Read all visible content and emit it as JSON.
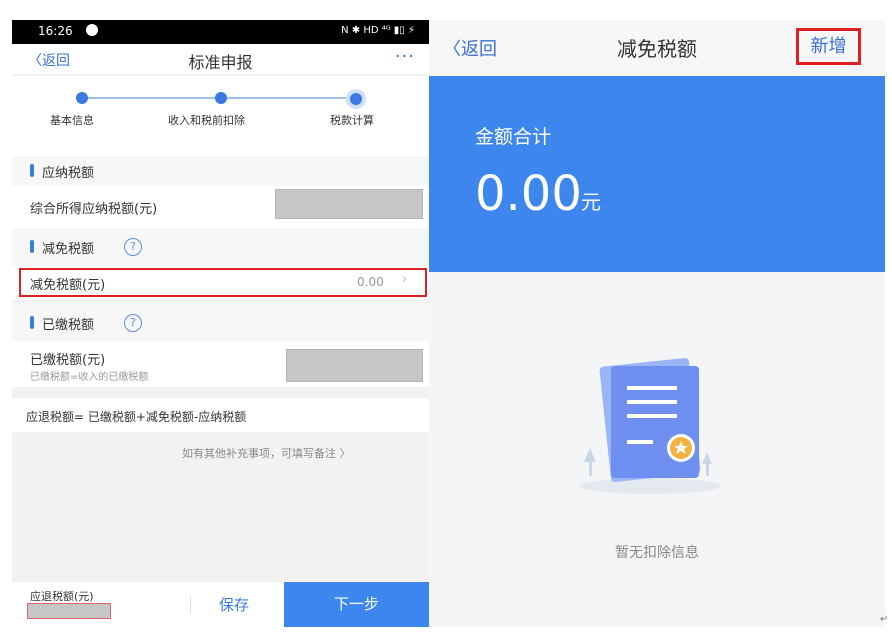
{
  "left": {
    "status": {
      "time": "16:26",
      "icons": "N ✱ HD ⁴ᴳ ▮▯ ⚡"
    },
    "nav": {
      "back": "返回",
      "title": "标准申报",
      "more": "···"
    },
    "steps": [
      "基本信息",
      "收入和税前扣除",
      "税款计算"
    ],
    "sections": {
      "payable": {
        "header": "应纳税额",
        "row_label": "综合所得应纳税额(元)"
      },
      "reduction": {
        "header": "减免税额",
        "row_label": "减免税额(元)",
        "row_value": "0.00"
      },
      "paid": {
        "header": "已缴税额",
        "row_label": "已缴税额(元)",
        "row_hint": "已缴税额=收入的已缴税额"
      }
    },
    "formula": "应退税额= 已缴税额+减免税额-应纳税额",
    "remark_link": "如有其他补充事项，可填写备注",
    "bottom": {
      "refund_label": "应退税额(元)",
      "save": "保存",
      "next": "下一步"
    }
  },
  "right": {
    "nav": {
      "back": "返回",
      "title": "减免税额",
      "add": "新增"
    },
    "summary": {
      "label": "金额合计",
      "amount": "0.00",
      "unit": "元"
    },
    "empty_text": "暂无扣除信息"
  },
  "colors": {
    "accent": "#3a7ae0",
    "banner": "#3d86ee",
    "highlight": "#e02020"
  }
}
